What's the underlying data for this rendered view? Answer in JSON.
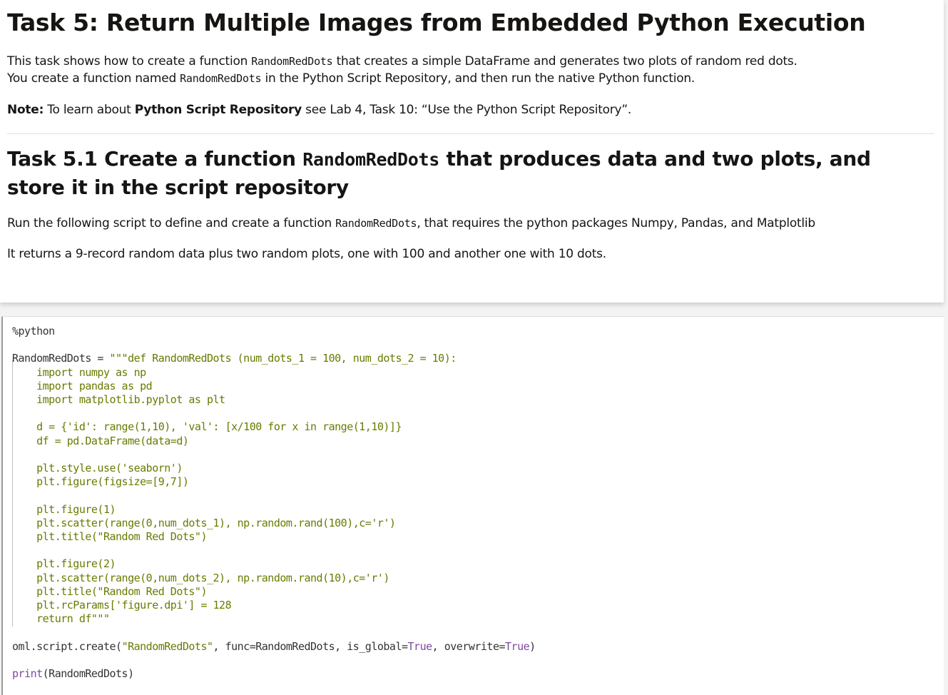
{
  "heading": "Task 5: Return Multiple Images from Embedded Python Execution",
  "intro": {
    "part1": "This task shows how to create a function ",
    "func1": "RandomRedDots",
    "part2": " that creates a simple DataFrame and generates two plots of random red dots.",
    "part3": "You create a function named ",
    "func2": "RandomRedDots",
    "part4": " in the Python Script Repository, and then run the native Python function."
  },
  "note": {
    "label": "Note:",
    "part1": " To learn about ",
    "bold": "Python Script Repository",
    "part2": " see Lab 4, Task 10: “Use the Python Script Repository”."
  },
  "subheading": {
    "part1": "Task 5.1 Create a function ",
    "func": "RandomRedDots",
    "part2": " that produces data and two plots, and store it in the script repository"
  },
  "para2": {
    "part1": "Run the following script to define and create a function ",
    "func": "RandomRedDots",
    "part2": ", that requires the python packages Numpy, Pandas, and Matplotlib"
  },
  "para3": "It returns a 9-record random data plus two random plots, one with 100 and another one with 10 dots.",
  "code": {
    "magic": "%python",
    "assign": "RandomRedDots = ",
    "body": "\"\"\"def RandomRedDots (num_dots_1 = 100, num_dots_2 = 10):\n    import numpy as np\n    import pandas as pd\n    import matplotlib.pyplot as plt\n\n    d = {'id': range(1,10), 'val': [x/100 for x in range(1,10)]}\n    df = pd.DataFrame(data=d)\n\n    plt.style.use('seaborn')\n    plt.figure(figsize=[9,7])\n\n    plt.figure(1)\n    plt.scatter(range(0,num_dots_1), np.random.rand(100),c='r')\n    plt.title(\"Random Red Dots\")\n\n    plt.figure(2)\n    plt.scatter(range(0,num_dots_2), np.random.rand(10),c='r')\n    plt.title(\"Random Red Dots\")\n    plt.rcParams['figure.dpi'] = 128\n    return df\"\"\"",
    "create_prefix": "oml.script.create(",
    "create_name": "\"RandomRedDots\"",
    "create_mid1": ", func=RandomRedDots, is_global=",
    "true1": "True",
    "create_mid2": ", overwrite=",
    "true2": "True",
    "create_end": ")",
    "print_kw": "print",
    "print_arg": "(RandomRedDots)"
  }
}
